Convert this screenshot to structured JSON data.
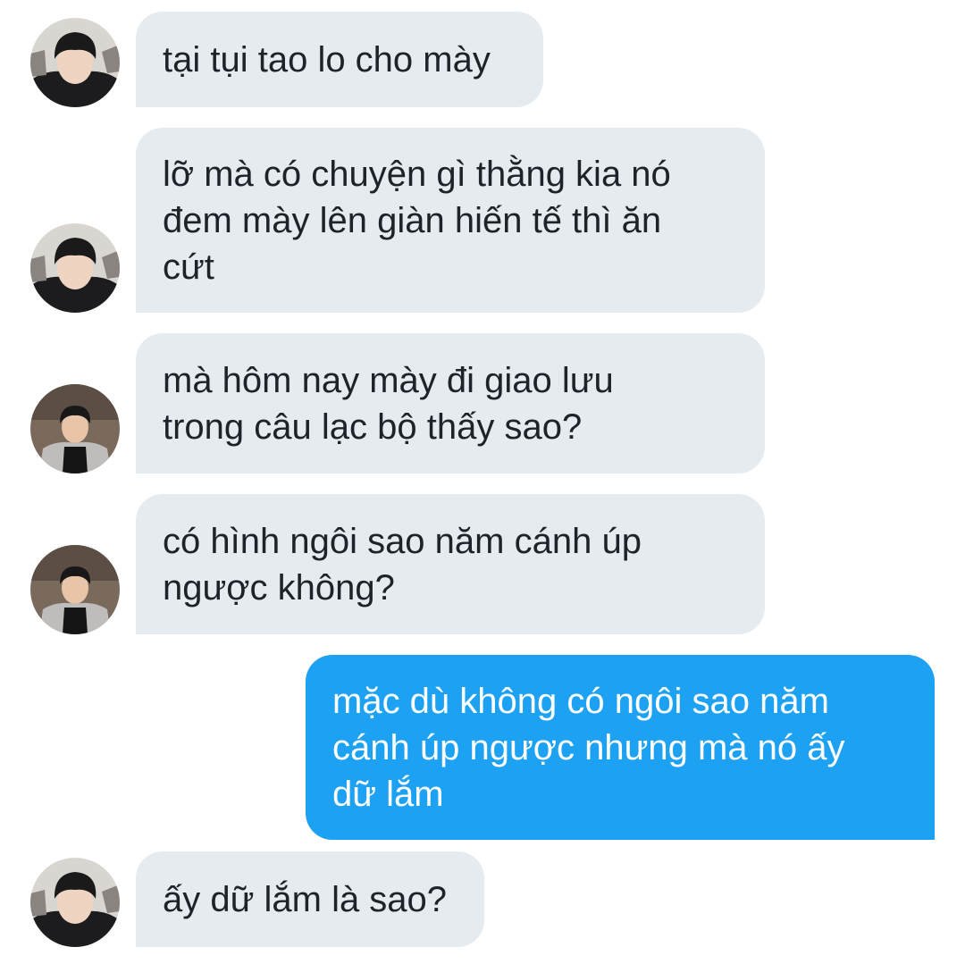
{
  "colors": {
    "incoming_bubble": "#e6ebf0",
    "outgoing_bubble": "#1da1f2",
    "incoming_text": "#1f2329",
    "outgoing_text": "#ffffff"
  },
  "messages": [
    {
      "direction": "incoming",
      "avatar": "avatar-a",
      "text": "tại tụi tao lo cho mày"
    },
    {
      "direction": "incoming",
      "avatar": "avatar-a",
      "text": "lỡ mà có chuyện gì thằng kia nó\nđem mày lên giàn hiến tế thì ăn\ncứt"
    },
    {
      "direction": "incoming",
      "avatar": "avatar-b",
      "text": "mà hôm nay mày đi giao lưu\ntrong câu lạc bộ thấy sao?"
    },
    {
      "direction": "incoming",
      "avatar": "avatar-b",
      "text": "có hình ngôi sao năm cánh úp\nngược không?"
    },
    {
      "direction": "outgoing",
      "text": "mặc dù không có ngôi sao năm\ncánh úp ngược nhưng mà nó ấy\ndữ lắm"
    },
    {
      "direction": "incoming",
      "avatar": "avatar-a",
      "text": "ấy dữ lắm là sao?"
    }
  ]
}
